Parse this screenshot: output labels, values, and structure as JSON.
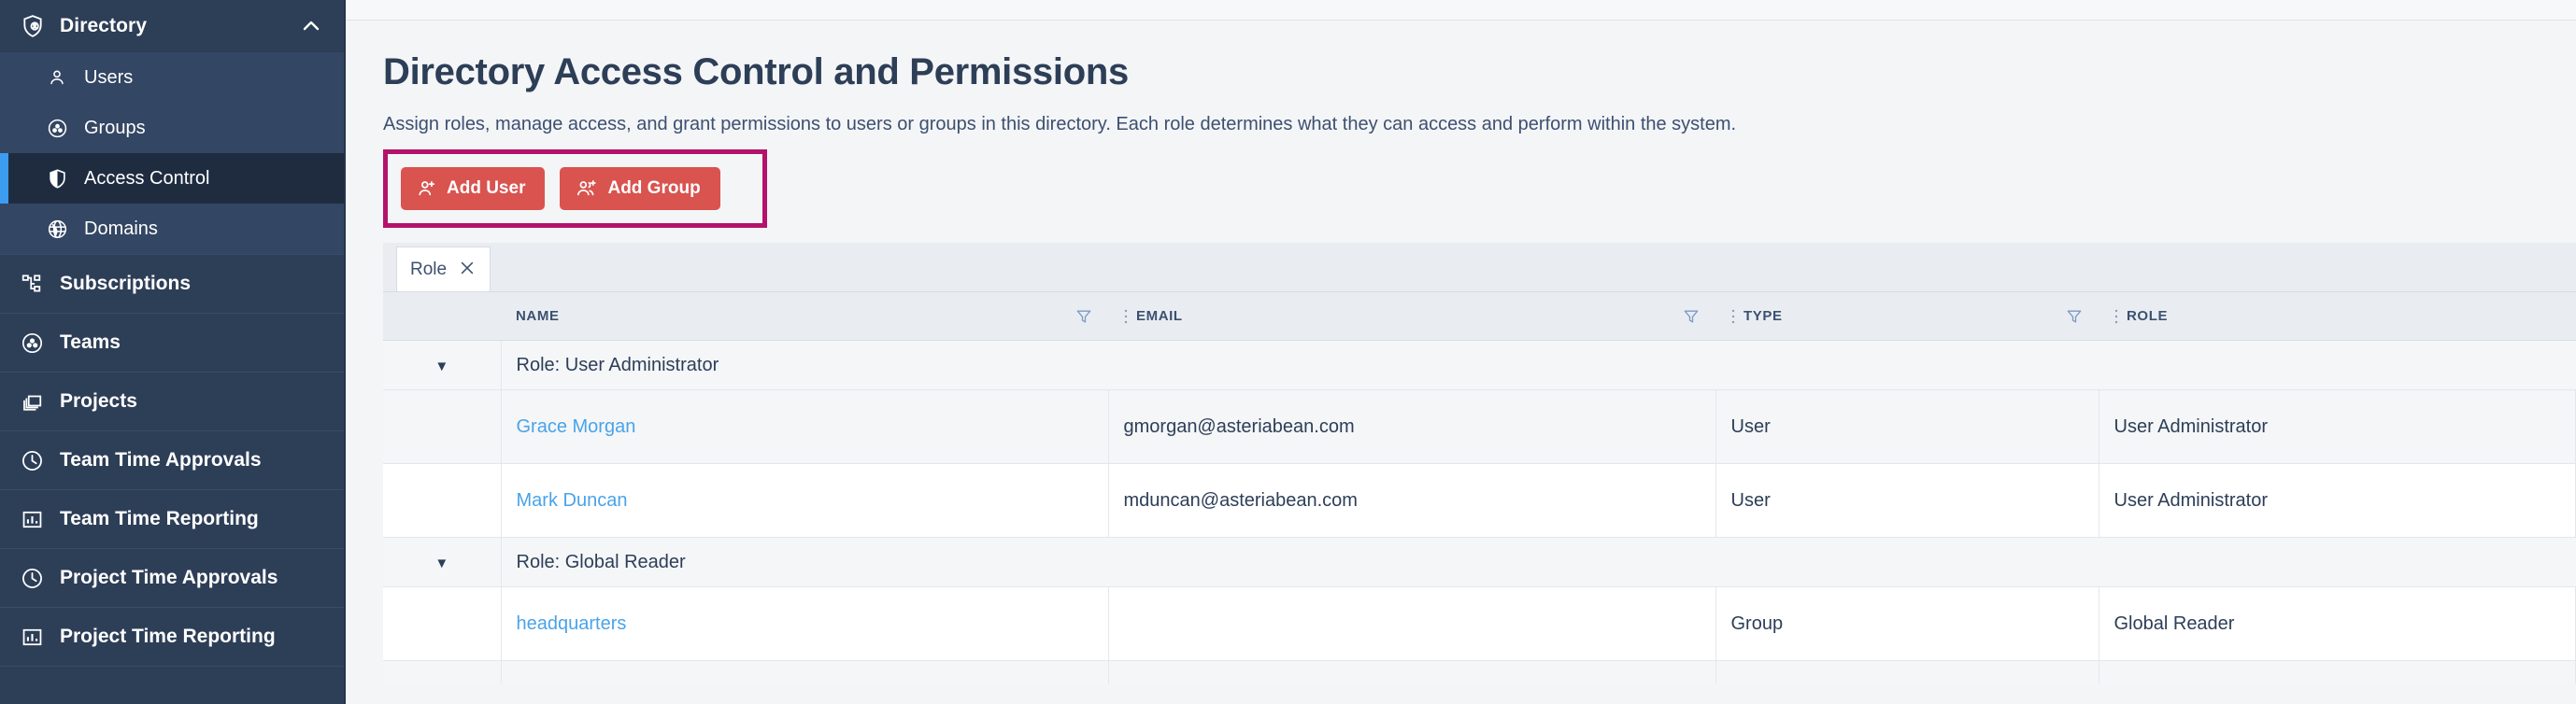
{
  "sidebar": {
    "group": {
      "label": "Directory",
      "icon": "shield-user-icon",
      "chevron": "chevron-up-icon",
      "expanded": true,
      "items": [
        {
          "label": "Users",
          "icon": "user-icon",
          "active": false
        },
        {
          "label": "Groups",
          "icon": "user-circle-icon",
          "active": false
        },
        {
          "label": "Access Control",
          "icon": "shield-icon",
          "active": true
        },
        {
          "label": "Domains",
          "icon": "globe-icon",
          "active": false
        }
      ]
    },
    "items": [
      {
        "label": "Subscriptions",
        "icon": "sitemap-icon"
      },
      {
        "label": "Teams",
        "icon": "user-circle-icon"
      },
      {
        "label": "Projects",
        "icon": "layers-icon"
      },
      {
        "label": "Team Time Approvals",
        "icon": "clock-icon"
      },
      {
        "label": "Team Time Reporting",
        "icon": "bar-chart-icon"
      },
      {
        "label": "Project Time Approvals",
        "icon": "clock-icon"
      },
      {
        "label": "Project Time Reporting",
        "icon": "bar-chart-icon"
      }
    ]
  },
  "page": {
    "title": "Directory Access Control and Permissions",
    "subtitle": "Assign roles, manage access, and grant permissions to users or groups in this directory. Each role determines what they can access and perform within the system."
  },
  "toolbar": {
    "add_user_label": "Add User",
    "add_group_label": "Add Group",
    "add_user_icon": "user-plus-icon",
    "add_group_icon": "users-plus-icon",
    "highlight_color": "#b4126b",
    "button_color": "#d9534f"
  },
  "filter_chip": {
    "label": "Role",
    "close_icon": "close-icon"
  },
  "table": {
    "columns": [
      {
        "key": "select",
        "label": ""
      },
      {
        "key": "name",
        "label": "NAME",
        "filter_icon": "funnel-icon"
      },
      {
        "key": "email",
        "label": "EMAIL",
        "filter_icon": "funnel-icon"
      },
      {
        "key": "type",
        "label": "TYPE",
        "filter_icon": "funnel-icon"
      },
      {
        "key": "role",
        "label": "ROLE",
        "filter_icon": ""
      }
    ],
    "groups": [
      {
        "label": "Role: User Administrator",
        "expanded": true,
        "arrow_icon": "caret-down-icon",
        "rows": [
          {
            "name": "Grace Morgan",
            "email": "gmorgan@asteriabean.com",
            "type": "User",
            "role": "User Administrator"
          },
          {
            "name": "Mark Duncan",
            "email": "mduncan@asteriabean.com",
            "type": "User",
            "role": "User Administrator"
          }
        ]
      },
      {
        "label": "Role: Global Reader",
        "expanded": true,
        "arrow_icon": "caret-down-icon",
        "rows": [
          {
            "name": "headquarters",
            "email": "",
            "type": "Group",
            "role": "Global Reader"
          }
        ]
      }
    ]
  },
  "colors": {
    "sidebar_bg": "#2d3e57",
    "sidebar_sub_bg": "#334663",
    "sidebar_active_bg": "#1f2c40",
    "accent_blue": "#3b9cf0",
    "link_blue": "#4aa3e8",
    "text_dark": "#2d3e57",
    "table_header_bg": "#e9edf2"
  }
}
